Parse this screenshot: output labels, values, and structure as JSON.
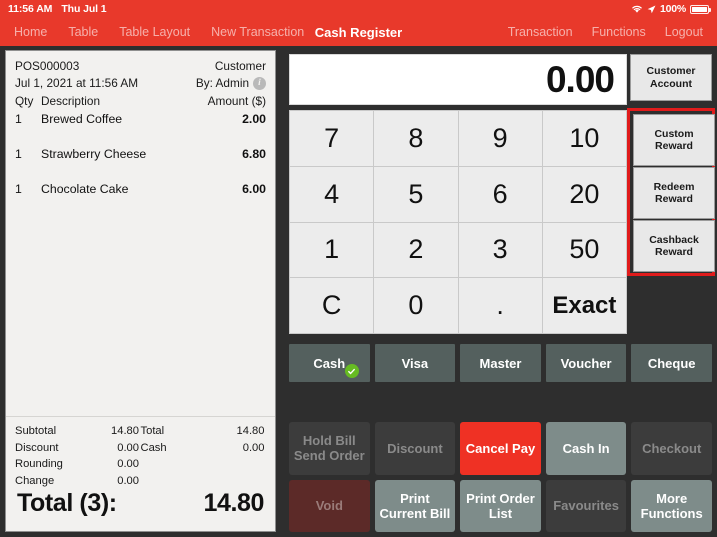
{
  "statusbar": {
    "time": "11:56 AM",
    "date": "Thu Jul 1",
    "battery_percent": "100%",
    "wifi_icon": "wifi-icon",
    "location_icon": "location-arrow-icon",
    "battery_icon": "battery-full-icon",
    "background": "#e8392b"
  },
  "navbar": {
    "title": "Cash Register",
    "left_items": [
      {
        "label": "Home"
      },
      {
        "label": "Table"
      },
      {
        "label": "Table Layout"
      },
      {
        "label": "New Transaction"
      }
    ],
    "right_items": [
      {
        "label": "Transaction"
      },
      {
        "label": "Functions"
      },
      {
        "label": "Logout"
      }
    ]
  },
  "receipt": {
    "order_no": "POS000003",
    "customer_label": "Customer",
    "datetime": "Jul 1, 2021 at 11:56 AM",
    "by_label": "By: Admin",
    "info_icon": "info-icon",
    "col_qty": "Qty",
    "col_description": "Description",
    "col_amount": "Amount ($)",
    "items": [
      {
        "qty": "1",
        "description": "Brewed Coffee",
        "amount": "2.00"
      },
      {
        "qty": "1",
        "description": "Strawberry Cheese",
        "amount": "6.80"
      },
      {
        "qty": "1",
        "description": "Chocolate Cake",
        "amount": "6.00"
      }
    ],
    "summary_left": [
      {
        "label": "Subtotal",
        "value": "14.80"
      },
      {
        "label": "Discount",
        "value": "0.00"
      },
      {
        "label": "Rounding",
        "value": "0.00"
      },
      {
        "label": "Change",
        "value": "0.00"
      }
    ],
    "summary_right": [
      {
        "label": "Total",
        "value": "14.80"
      },
      {
        "label": "Cash",
        "value": "0.00"
      }
    ],
    "total_label": "Total (3):",
    "total_value": "14.80"
  },
  "display": {
    "value": "0.00"
  },
  "keypad": {
    "keys": [
      {
        "label": "7",
        "style": "num"
      },
      {
        "label": "8",
        "style": "num"
      },
      {
        "label": "9",
        "style": "num"
      },
      {
        "label": "10",
        "style": "num"
      },
      {
        "label": "4",
        "style": "num"
      },
      {
        "label": "5",
        "style": "num"
      },
      {
        "label": "6",
        "style": "num"
      },
      {
        "label": "20",
        "style": "num"
      },
      {
        "label": "1",
        "style": "num"
      },
      {
        "label": "2",
        "style": "num"
      },
      {
        "label": "3",
        "style": "num"
      },
      {
        "label": "50",
        "style": "num"
      },
      {
        "label": "C",
        "style": "num"
      },
      {
        "label": "0",
        "style": "num"
      },
      {
        "label": ".",
        "style": "num"
      },
      {
        "label": "Exact",
        "style": "word"
      }
    ]
  },
  "right_column": {
    "customer_account": "Customer\nAccount",
    "customer_account_line1": "Customer",
    "customer_account_line2": "Account",
    "highlight_color": "#e01b1b",
    "rewards": [
      {
        "line1": "Custom",
        "line2": "Reward"
      },
      {
        "line1": "Redeem",
        "line2": "Reward"
      },
      {
        "line1": "Cashback",
        "line2": "Reward"
      }
    ]
  },
  "payment_methods": [
    {
      "label": "Cash",
      "selected": true,
      "check_icon": "check-circle-icon"
    },
    {
      "label": "Visa",
      "selected": false
    },
    {
      "label": "Master",
      "selected": false
    },
    {
      "label": "Voucher",
      "selected": false
    },
    {
      "label": "Cheque",
      "selected": false
    }
  ],
  "actions": [
    {
      "line1": "Hold Bill",
      "line2": "Send Order",
      "state": "disabled"
    },
    {
      "line1": "Discount",
      "line2": "",
      "state": "disabled"
    },
    {
      "line1": "Cancel Pay",
      "line2": "",
      "state": "danger"
    },
    {
      "line1": "Cash In",
      "line2": "",
      "state": "enabled"
    },
    {
      "line1": "Checkout",
      "line2": "",
      "state": "disabled"
    },
    {
      "line1": "Void",
      "line2": "",
      "state": "void"
    },
    {
      "line1": "Print",
      "line2": "Current Bill",
      "state": "enabled"
    },
    {
      "line1": "Print Order",
      "line2": "List",
      "state": "enabled"
    },
    {
      "line1": "Favourites",
      "line2": "",
      "state": "disabled"
    },
    {
      "line1": "More",
      "line2": "Functions",
      "state": "enabled"
    }
  ]
}
